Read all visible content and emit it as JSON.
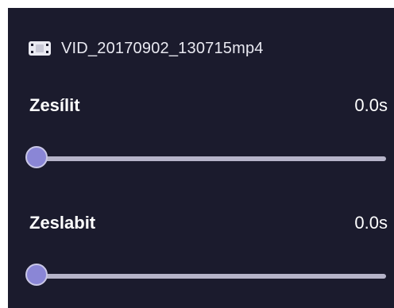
{
  "file": {
    "icon": "film-icon",
    "name": "VID_20170902_130715mp4"
  },
  "fade_in": {
    "label": "Zesílit",
    "value": "0.0s",
    "level": 0
  },
  "fade_out": {
    "label": "Zeslabit",
    "value": "0.0s",
    "level": 0
  },
  "colors": {
    "panel_background": "#1b1b2d",
    "accent": "#8a86d6",
    "track": "#b6b4c9"
  }
}
